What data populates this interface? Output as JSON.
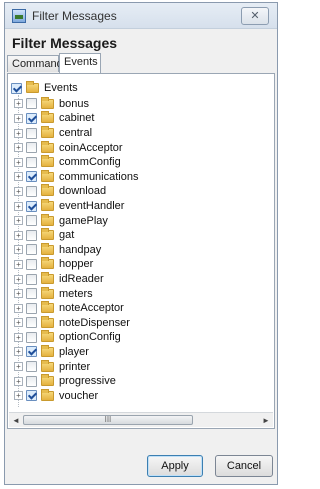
{
  "window": {
    "title": "Filter Messages",
    "close_label": "✕"
  },
  "heading": "Filter Messages",
  "tabs": [
    {
      "label": "Commands",
      "selected": false
    },
    {
      "label": "Events",
      "selected": true
    }
  ],
  "tree": {
    "root": {
      "label": "Events",
      "checked": true
    },
    "items": [
      {
        "label": "bonus",
        "checked": false
      },
      {
        "label": "cabinet",
        "checked": true
      },
      {
        "label": "central",
        "checked": false
      },
      {
        "label": "coinAcceptor",
        "checked": false
      },
      {
        "label": "commConfig",
        "checked": false
      },
      {
        "label": "communications",
        "checked": true
      },
      {
        "label": "download",
        "checked": false
      },
      {
        "label": "eventHandler",
        "checked": true
      },
      {
        "label": "gamePlay",
        "checked": false
      },
      {
        "label": "gat",
        "checked": false
      },
      {
        "label": "handpay",
        "checked": false
      },
      {
        "label": "hopper",
        "checked": false
      },
      {
        "label": "idReader",
        "checked": false
      },
      {
        "label": "meters",
        "checked": false
      },
      {
        "label": "noteAcceptor",
        "checked": false
      },
      {
        "label": "noteDispenser",
        "checked": false
      },
      {
        "label": "optionConfig",
        "checked": false
      },
      {
        "label": "player",
        "checked": true
      },
      {
        "label": "printer",
        "checked": false
      },
      {
        "label": "progressive",
        "checked": false
      },
      {
        "label": "voucher",
        "checked": true
      }
    ]
  },
  "scrollbar": {
    "left_arrow": "◄",
    "right_arrow": "►",
    "thumb_grip": "III"
  },
  "buttons": {
    "apply": "Apply",
    "cancel": "Cancel"
  }
}
